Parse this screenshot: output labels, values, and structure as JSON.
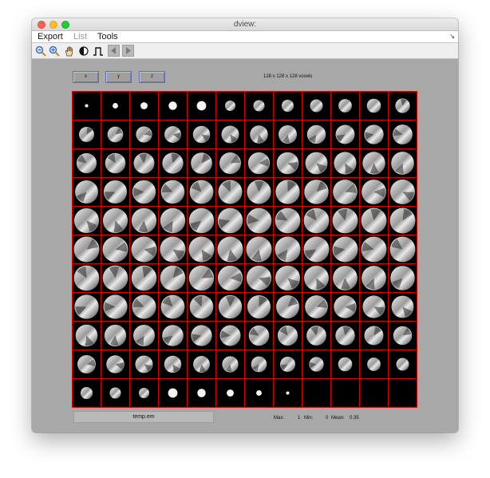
{
  "window": {
    "title": "dview:"
  },
  "menubar": {
    "export_label": "Export",
    "list_label": "List",
    "tools_label": "Tools"
  },
  "toolbar": {
    "icons": [
      "zoom-out-icon",
      "zoom-in-icon",
      "pan-hand-icon",
      "contrast-icon",
      "pulse-icon",
      "previous-arrow-icon",
      "next-arrow-icon"
    ]
  },
  "view_buttons": {
    "x_label": "x",
    "y_label": "y",
    "z_label": "z"
  },
  "volume_info": "128 x 128 x 128 voxels",
  "montage": {
    "rows": 11,
    "columns": 12,
    "slices_shown": 128,
    "grid_color": "#d40000"
  },
  "status": {
    "filename": "temp.em",
    "max_label": "Max:",
    "max_value": "1",
    "min_label": "Min:",
    "min_value": "0",
    "mean_label": "Mean:",
    "mean_value": "0.35"
  }
}
